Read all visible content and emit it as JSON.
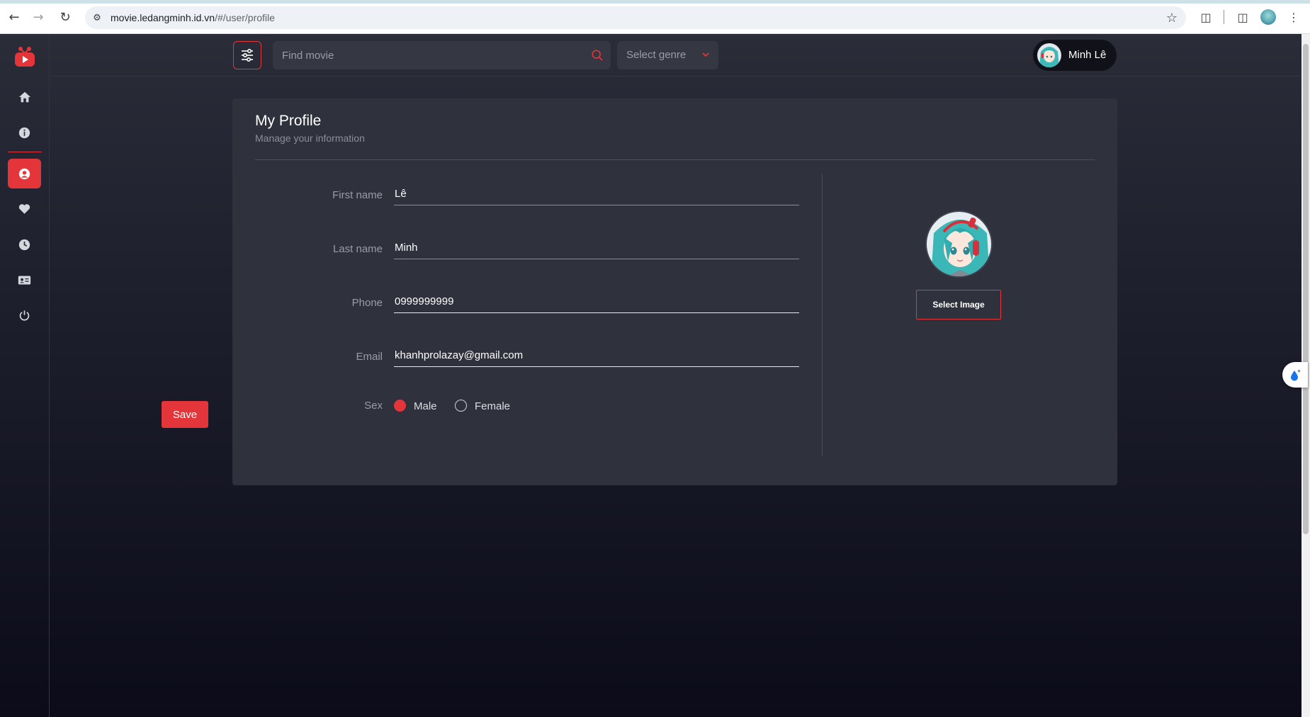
{
  "browser": {
    "url_host": "movie.ledangminh.id.vn",
    "url_path": "/#/user/profile"
  },
  "header": {
    "search_placeholder": "Find movie",
    "genre_label": "Select genre",
    "user_name": "Minh Lê"
  },
  "sidebar": {
    "items": [
      {
        "icon": "home-icon"
      },
      {
        "icon": "info-icon"
      },
      {
        "icon": "user-icon",
        "active": true
      },
      {
        "icon": "heart-icon"
      },
      {
        "icon": "clock-icon"
      },
      {
        "icon": "id-card-icon"
      },
      {
        "icon": "power-icon"
      }
    ]
  },
  "profile": {
    "title": "My Profile",
    "subtitle": "Manage your information",
    "first_name_label": "First name",
    "first_name": "Lê",
    "last_name_label": "Last name",
    "last_name": "Minh",
    "phone_label": "Phone",
    "phone": "0999999999",
    "email_label": "Email",
    "email": "khanhprolazay@gmail.com",
    "sex_label": "Sex",
    "sex_options": [
      "Male",
      "Female"
    ],
    "sex_selected": "Male",
    "save_label": "Save",
    "select_image_label": "Select Image"
  },
  "colors": {
    "accent": "#e4353b",
    "card": "#2f313d"
  }
}
